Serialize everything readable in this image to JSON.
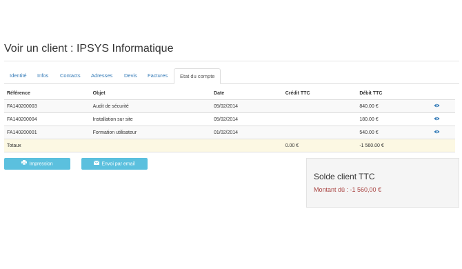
{
  "page": {
    "title": "Voir un client : IPSYS Informatique"
  },
  "tabs": [
    {
      "label": "Identité"
    },
    {
      "label": "Infos"
    },
    {
      "label": "Contacts"
    },
    {
      "label": "Adresses"
    },
    {
      "label": "Devis"
    },
    {
      "label": "Factures"
    },
    {
      "label": "Etat du compte",
      "active": true
    }
  ],
  "table": {
    "headers": [
      "Référence",
      "Objet",
      "Date",
      "Crédit TTC",
      "Débit TTC",
      ""
    ],
    "rows": [
      {
        "reference": "FA140200003",
        "objet": "Audit de sécurité",
        "date": "05/02/2014",
        "credit": "",
        "debit": "840.00 €"
      },
      {
        "reference": "FA140200004",
        "objet": "Installation sur site",
        "date": "05/02/2014",
        "credit": "",
        "debit": "180.00 €"
      },
      {
        "reference": "FA140200001",
        "objet": "Formation utilisateur",
        "date": "01/02/2014",
        "credit": "",
        "debit": "540.00 €"
      }
    ],
    "totals": {
      "label": "Totaux",
      "credit": "0.00 €",
      "debit": "-1 560.00 €"
    }
  },
  "buttons": {
    "print_label": "Impression",
    "email_label": "Envoi par email"
  },
  "solde": {
    "title": "Solde client TTC",
    "amount": "Montant dû : -1 560,00 €"
  },
  "colors": {
    "link": "#337ab7",
    "button": "#5bc0de",
    "totals_row": "#fcf8e3",
    "amount_due": "#a94442"
  },
  "icons": [
    "eye-icon",
    "print-icon",
    "envelope-icon"
  ]
}
